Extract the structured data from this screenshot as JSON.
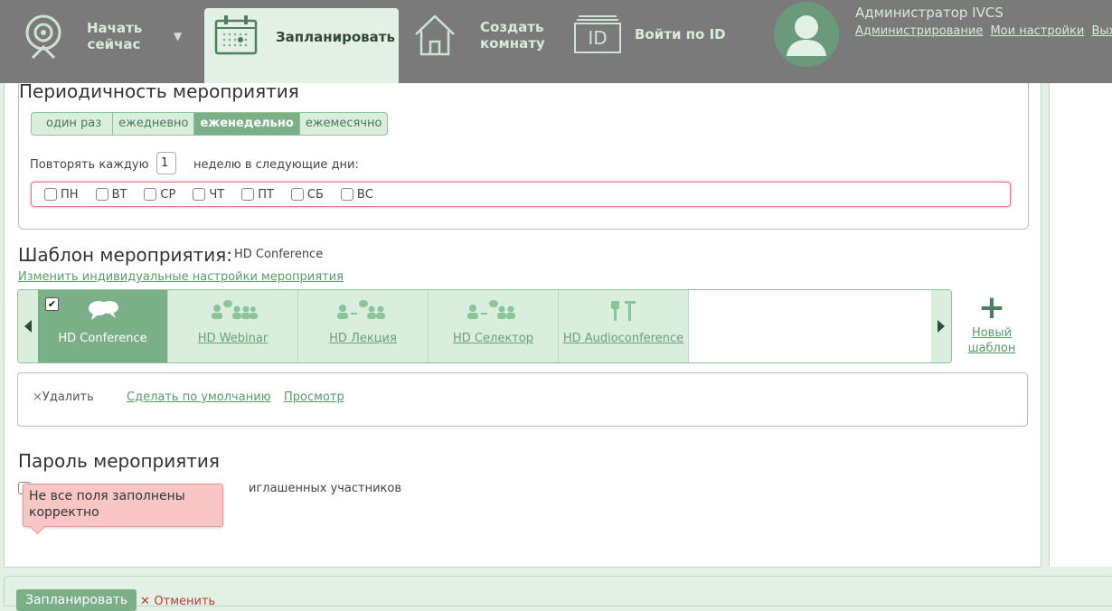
{
  "nav": {
    "start_now": "Начать сейчас",
    "schedule": "Запланировать",
    "create_room": "Создать комнату",
    "login_by_id": "Войти по ID",
    "id_box": "ID"
  },
  "user": {
    "name": "Администратор IVCS",
    "links": [
      "Администрирование",
      "Мои настройки",
      "Выход"
    ]
  },
  "periodicity": {
    "title": "Периодичность мероприятия",
    "options": [
      "один раз",
      "ежедневно",
      "еженедельно",
      "ежемесячно"
    ],
    "selected": "еженедельно",
    "repeat_label": "Повторять каждую",
    "repeat_value": "1",
    "repeat_suffix": "неделю в следующие дни:",
    "days": [
      "ПН",
      "ВТ",
      "СР",
      "ЧТ",
      "ПТ",
      "СБ",
      "ВС"
    ]
  },
  "template": {
    "title": "Шаблон мероприятия:",
    "current": "HD Conference",
    "change_link": "Изменить индивидуальные настройки мероприятия",
    "items": [
      "HD Conference",
      "HD Webinar",
      "HD Лекция",
      "HD Селектор",
      "HD Audioconference"
    ],
    "new_template": "Новый шаблон"
  },
  "actions": {
    "delete": "Удалить",
    "make_default": "Сделать по умолчанию",
    "preview": "Просмотр"
  },
  "password": {
    "title": "Пароль мероприятия",
    "checkbox_label_partial": "иглашенных участников"
  },
  "error": {
    "message": "Не все поля заполнены корректно"
  },
  "footer": {
    "schedule_button": "Запланировать",
    "cancel": "Отменить"
  },
  "colors": {
    "topbar": "#7a7a7a",
    "accent_green": "#7aaf88",
    "light_green": "#d9eedc",
    "error_bg": "#f9c6c6"
  }
}
